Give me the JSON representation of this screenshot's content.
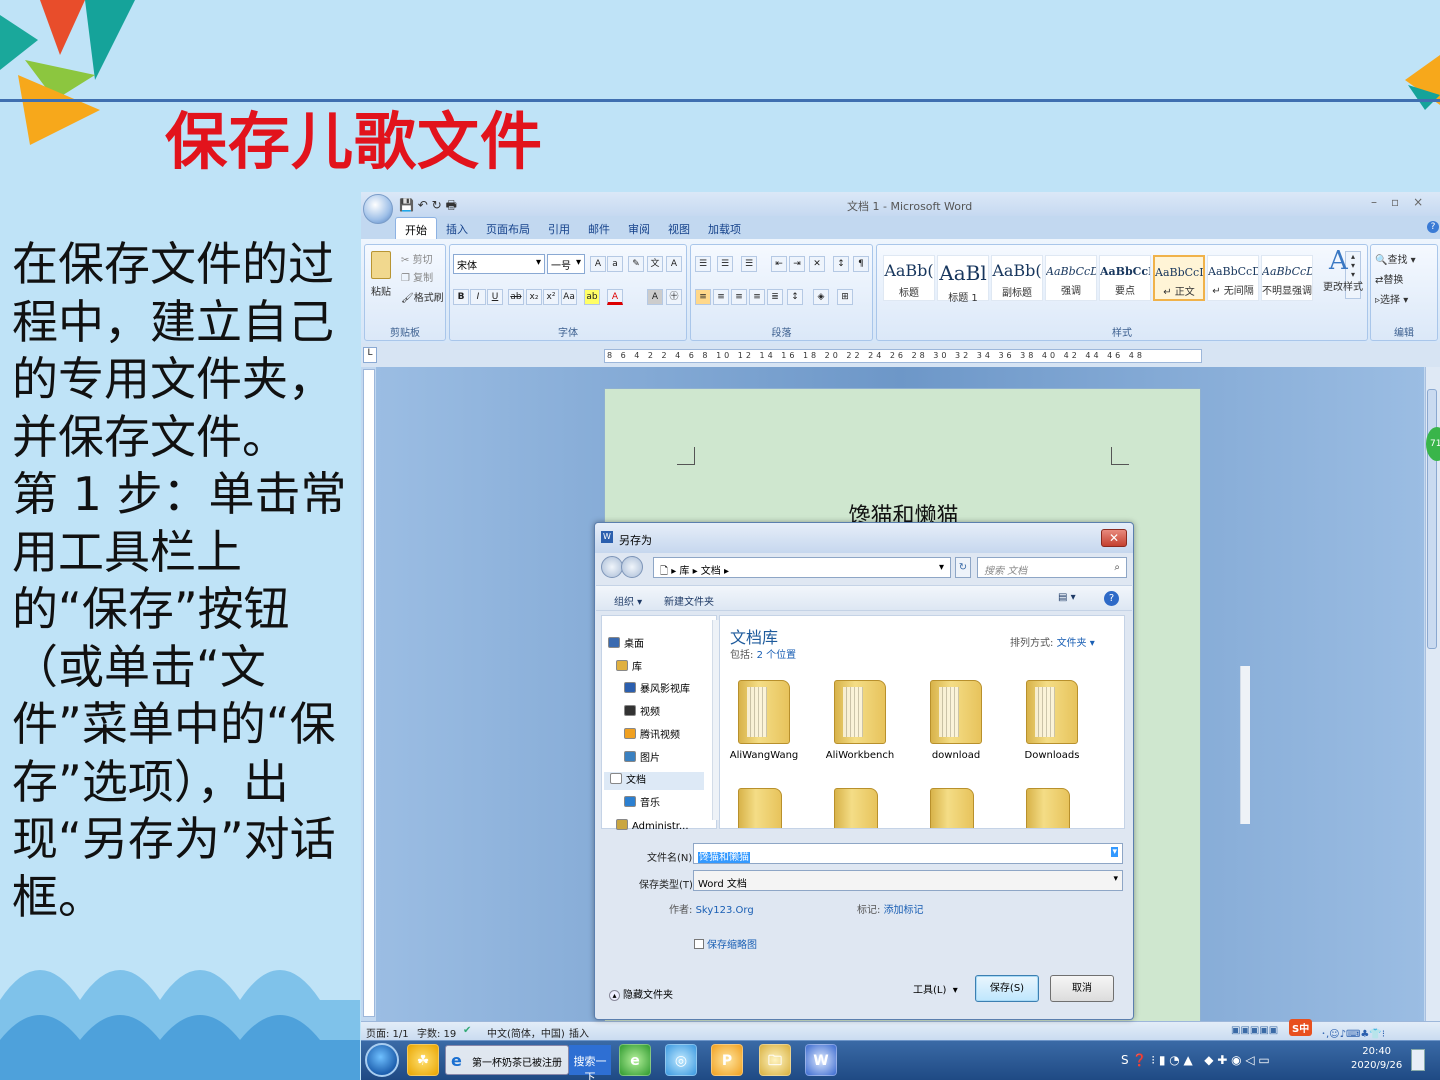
{
  "slide": {
    "title": "保存儿歌文件",
    "body": "    在保存文件的过程中，建立自己的专用文件夹，并保存文件。\n第 1 步：单击常用工具栏上的“保存”按钮（或单击“文件”菜单中的“保存”选项），出现“另存为”对话框。",
    "colors": {
      "background": "#bfe3f7",
      "title": "#e2131c",
      "rule": "#3f6fb0"
    }
  },
  "word": {
    "window_title": "文档 1 - Microsoft Word",
    "tabs": [
      "开始",
      "插入",
      "页面布局",
      "引用",
      "邮件",
      "审阅",
      "视图",
      "加载项"
    ],
    "active_tab": "开始",
    "clipboard": {
      "paste": "粘贴",
      "cut": "剪切",
      "copy": "复制",
      "format_painter": "格式刷",
      "label": "剪贴板"
    },
    "font": {
      "family": "宋体",
      "size": "一号",
      "label": "字体"
    },
    "paragraph": {
      "label": "段落"
    },
    "styles": {
      "label": "样式",
      "items": [
        {
          "preview": "AaBb(",
          "name": "标题"
        },
        {
          "preview": "AaBl",
          "name": "标题 1"
        },
        {
          "preview": "AaBb(",
          "name": "副标题"
        },
        {
          "preview": "AaBbCcDı",
          "name": "强调"
        },
        {
          "preview": "AaBbCcD",
          "name": "要点"
        },
        {
          "preview": "AaBbCcD(",
          "name": "↵ 正文"
        },
        {
          "preview": "AaBbCcD(",
          "name": "↵ 无间隔"
        },
        {
          "preview": "AaBbCcD(",
          "name": "不明显强调"
        }
      ],
      "change": "更改样式"
    },
    "editing": {
      "find": "查找",
      "replace": "替换",
      "select": "选择",
      "label": "编辑"
    },
    "ruler": "8 6 4 2 2 4 6 8 10 12 14 16 18 20 22 24 26 28 30 32 34 36 38 40 42 44 46 48",
    "document_heading": "馋猫和懒猫",
    "status": {
      "page": "页面: 1/1",
      "words": "字数: 19",
      "language": "中文(简体，中国)",
      "mode": "插入"
    },
    "side_badge": "71"
  },
  "dialog": {
    "title": "另存为",
    "breadcrumb": "库 ▸ 文档 ▸",
    "search_placeholder": "搜索 文档",
    "toolbar": {
      "organize": "组织 ▾",
      "new_folder": "新建文件夹"
    },
    "nav_items": [
      "桌面",
      "库",
      "暴风影视库",
      "视频",
      "腾讯视频",
      "图片",
      "文档",
      "音乐",
      "Administr..."
    ],
    "library_title": "文档库",
    "library_includes": "包括:",
    "library_locations": "2 个位置",
    "sort_label": "排列方式:",
    "sort_value": "文件夹 ▾",
    "folders": [
      "AliWangWang",
      "AliWorkbench",
      "download",
      "Downloads"
    ],
    "filename_label": "文件名(N):",
    "filename_value": "馋猫和懒猫",
    "filetype_label": "保存类型(T):",
    "filetype_value": "Word 文档",
    "author_label": "作者:",
    "author_value": "Sky123.Org",
    "tags_label": "标记:",
    "tags_value": "添加标记",
    "thumbnail_label": "保存缩略图",
    "hide_folders": "隐藏文件夹",
    "tools": "工具(L)",
    "save": "保存(S)",
    "cancel": "取消"
  },
  "taskbar": {
    "ie_item": "第一杯奶茶已被注册",
    "search_btn": "搜索一下",
    "time": "20:40",
    "date": "2020/9/26",
    "ime": "S中"
  }
}
